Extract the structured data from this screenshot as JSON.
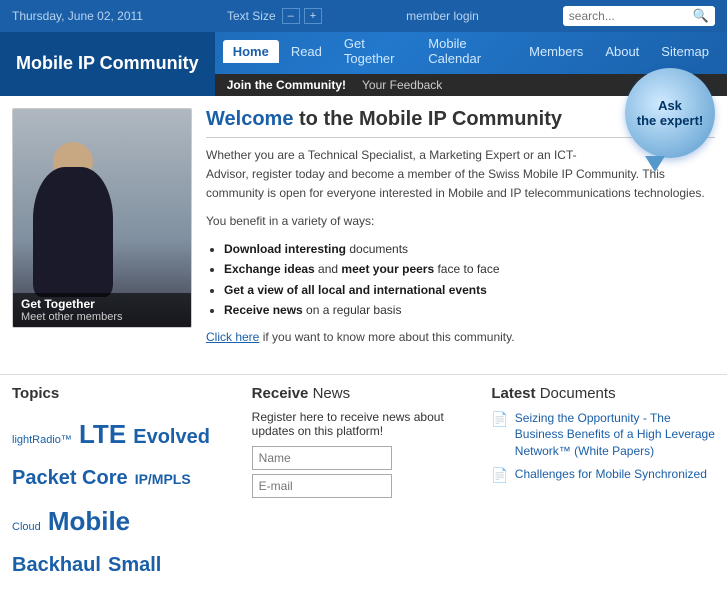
{
  "topbar": {
    "date": "Thursday, June 02, 2011",
    "text_size_label": "Text Size",
    "text_size_minus": "–",
    "text_size_plus": "+",
    "member_login": "member login",
    "search_placeholder": "search..."
  },
  "header": {
    "site_title": "Mobile IP Community",
    "nav_items": [
      {
        "label": "Home",
        "active": true
      },
      {
        "label": "Read",
        "active": false
      },
      {
        "label": "Get Together",
        "active": false
      },
      {
        "label": "Mobile Calendar",
        "active": false
      },
      {
        "label": "Members",
        "active": false
      },
      {
        "label": "About",
        "active": false
      },
      {
        "label": "Sitemap",
        "active": false
      }
    ],
    "sub_nav_items": [
      {
        "label": "Join the Community!",
        "highlight": true
      },
      {
        "label": "Your Feedback",
        "highlight": false
      }
    ]
  },
  "hero": {
    "caption_title": "Get Together",
    "caption_sub": "Meet other members"
  },
  "welcome": {
    "heading_bold": "Welcome",
    "heading_rest": " to the Mobile IP Community",
    "paragraph1": "Whether you are a Technical Specialist, a Marketing Expert or an ICT-Advisor, register today and become a member of the Swiss Mobile IP Community. This community is open for everyone interested in Mobile and IP telecommunications technologies.",
    "paragraph2": "You benefit in a variety of ways:",
    "bullets": [
      {
        "text": "Download interesting documents",
        "bold_part": "Download interesting"
      },
      {
        "text": "Exchange ideas and meet your peers face to face",
        "bold_part": "Exchange ideas"
      },
      {
        "text": "Get a view of all local and international events",
        "bold_part": "Get a view of all local and international events"
      },
      {
        "text": "Receive news on a regular basis",
        "bold_part": "Receive news"
      }
    ],
    "click_here_text": "Click here",
    "click_here_rest": " if you want to know more about this community.",
    "ask_expert_line1": "Ask",
    "ask_expert_line2": "the expert!"
  },
  "topics": {
    "heading": "Topics",
    "words": [
      {
        "text": "lightRadio™",
        "size": "sm"
      },
      {
        "text": "LTE",
        "size": "xl"
      },
      {
        "text": "Evolved Packet Core",
        "size": "lg"
      },
      {
        "text": "IP/MPLS",
        "size": "md"
      },
      {
        "text": "Cloud",
        "size": "sm"
      },
      {
        "text": "Mobile",
        "size": "xl"
      },
      {
        "text": "Backhaul",
        "size": "lg"
      },
      {
        "text": "Small",
        "size": "lg"
      }
    ]
  },
  "receive_news": {
    "heading_bold": "Receive",
    "heading_rest": " News",
    "description": "Register here to receive news about updates on this platform!",
    "name_placeholder": "Name",
    "email_placeholder": "E-mail"
  },
  "latest_docs": {
    "heading_bold": "Latest",
    "heading_rest": " Documents",
    "items": [
      {
        "icon": "📄",
        "text": "Seizing the Opportunity - The Business Benefits of a High Leverage Network™ (White Papers)"
      },
      {
        "icon": "📄",
        "text": "Challenges for Mobile Synchronized"
      }
    ]
  }
}
